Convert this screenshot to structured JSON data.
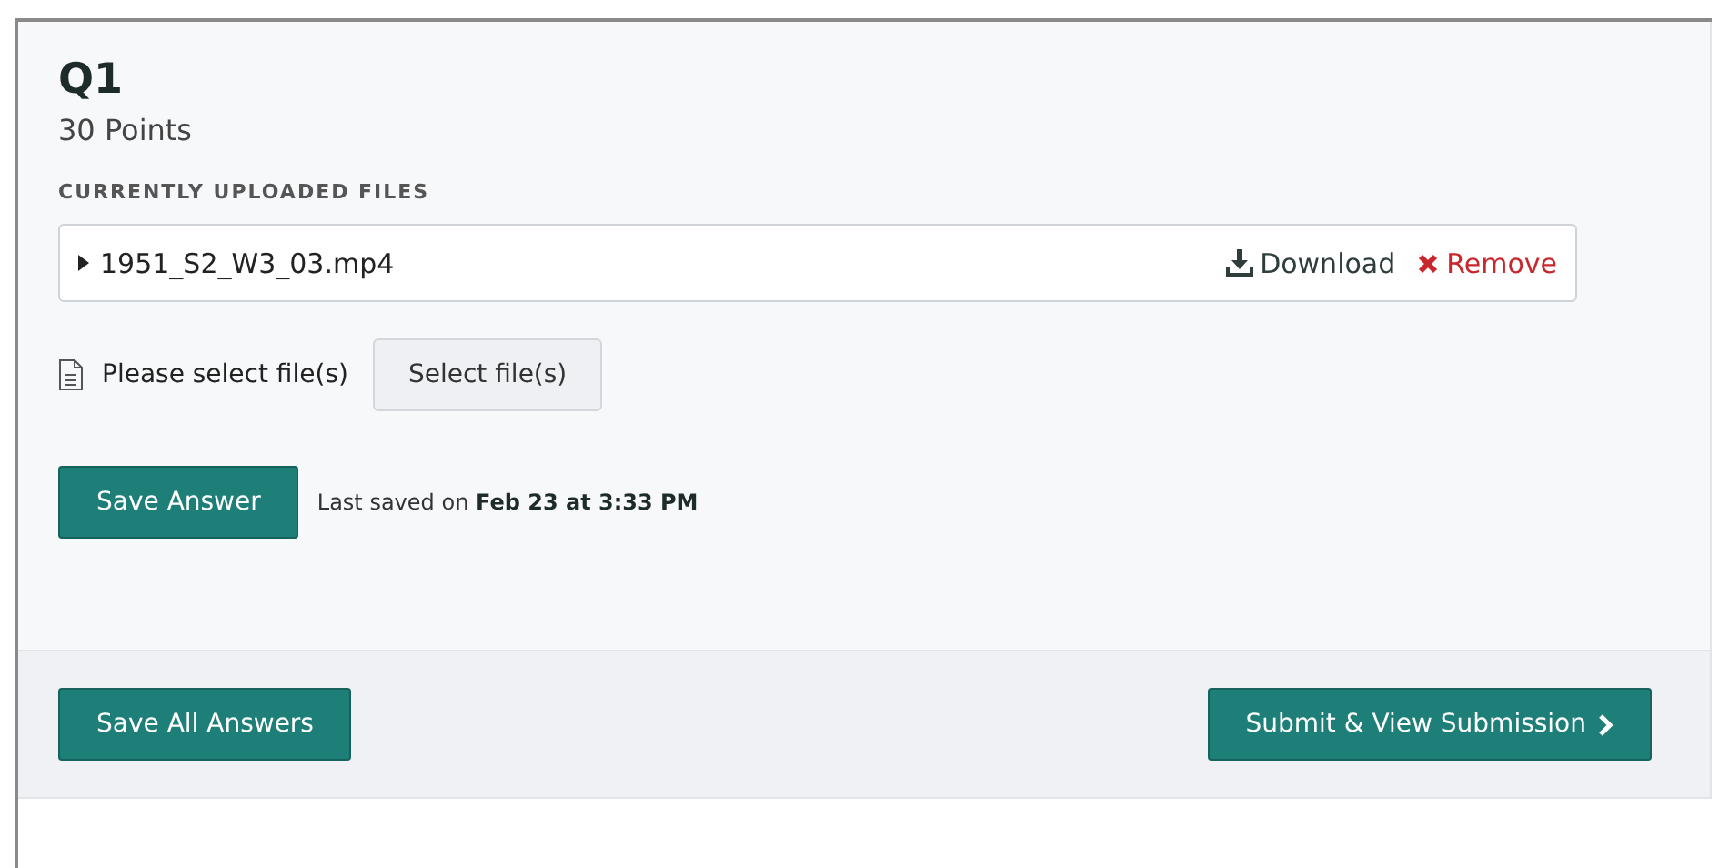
{
  "question": {
    "title": "Q1",
    "points": "30 Points"
  },
  "uploads": {
    "heading": "CURRENTLY UPLOADED FILES",
    "files": [
      {
        "name": "1951_S2_W3_03.mp4",
        "expanded": false,
        "download": "Download",
        "remove": "Remove"
      }
    ]
  },
  "picker": {
    "hint": "Please select file(s)",
    "button": "Select file(s)"
  },
  "save": {
    "button": "Save Answer",
    "status": "Last saved on **Feb 23 at 3:33 PM**"
  },
  "footer": {
    "save_all": "Save All Answers",
    "submit": "Submit & View Submission"
  }
}
